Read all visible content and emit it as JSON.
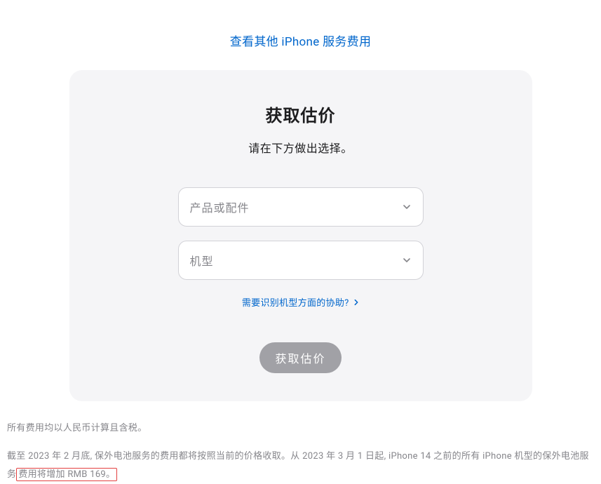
{
  "header": {
    "link_text": "查看其他 iPhone 服务费用"
  },
  "card": {
    "title": "获取估价",
    "subtitle": "请在下方做出选择。",
    "select_product_placeholder": "产品或配件",
    "select_model_placeholder": "机型",
    "help_link_text": "需要识别机型方面的协助?",
    "submit_label": "获取估价"
  },
  "footer": {
    "line1": "所有费用均以人民币计算且含税。",
    "line2_part1": "截至 2023 年 2 月底, 保外电池服务的费用都将按照当前的价格收取。从 2023 年 3 月 1 日起, iPhone 14 之前的所有 iPhone 机型的保外电池服务",
    "line2_highlight": "费用将增加 RMB 169。"
  }
}
